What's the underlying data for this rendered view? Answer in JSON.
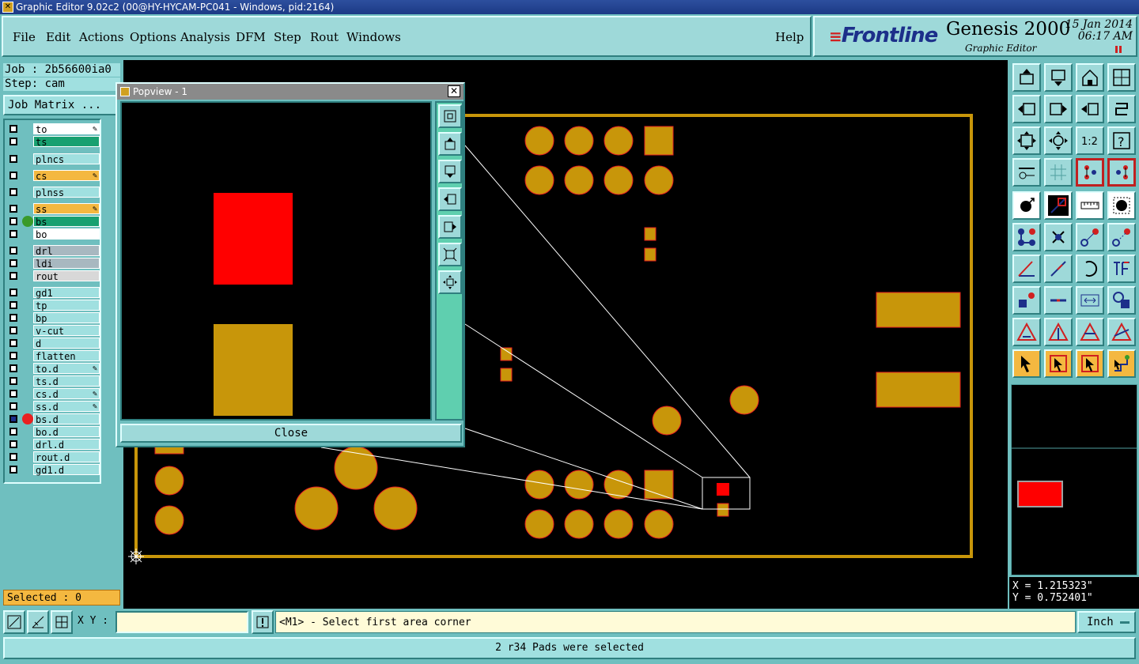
{
  "window": {
    "title": "Graphic Editor 9.02c2 (00@HY-HYCAM-PC041 - Windows, pid:2164)"
  },
  "menu": [
    "File",
    "Edit",
    "Actions",
    "Options",
    "Analysis",
    "DFM",
    "Step",
    "Rout",
    "Windows"
  ],
  "help": "Help",
  "brand": {
    "name": "Frontline",
    "product": "Genesis 2000",
    "subtitle": "Graphic Editor",
    "date": "15 Jan 2014",
    "time": "06:17 AM"
  },
  "job": {
    "job_label": "Job : 2b56600ia0",
    "step_label": "Step: cam",
    "matrix_button": "Job Matrix ..."
  },
  "layers": [
    {
      "name": "to",
      "bg": "#ffffff",
      "editable": true
    },
    {
      "name": "ts",
      "bg": "#18a070",
      "editable": false
    },
    {
      "name": "plncs",
      "bg": "#a0e0e0",
      "editable": false
    },
    {
      "name": "cs",
      "bg": "#f4b840",
      "editable": true
    },
    {
      "name": "plnss",
      "bg": "#a0e0e0",
      "editable": false
    },
    {
      "name": "ss",
      "bg": "#f4b840",
      "editable": true
    },
    {
      "name": "bs",
      "bg": "#18a070",
      "editable": false,
      "dot": "#3a9a2a"
    },
    {
      "name": "bo",
      "bg": "#ffffff",
      "editable": false
    },
    {
      "name": "drl",
      "bg": "#a8b8c0",
      "editable": false
    },
    {
      "name": "ldi",
      "bg": "#a8b8c0",
      "editable": false
    },
    {
      "name": "rout",
      "bg": "#d8d8d8",
      "editable": false
    },
    {
      "name": "gd1",
      "bg": "#a0e0e0",
      "editable": false
    },
    {
      "name": "tp",
      "bg": "#a0e0e0",
      "editable": false
    },
    {
      "name": "bp",
      "bg": "#a0e0e0",
      "editable": false
    },
    {
      "name": "v-cut",
      "bg": "#a0e0e0",
      "editable": false
    },
    {
      "name": "d",
      "bg": "#a0e0e0",
      "editable": false
    },
    {
      "name": "flatten",
      "bg": "#a0e0e0",
      "editable": false
    },
    {
      "name": "to.d",
      "bg": "#a0e0e0",
      "editable": true
    },
    {
      "name": "ts.d",
      "bg": "#a0e0e0",
      "editable": false
    },
    {
      "name": "cs.d",
      "bg": "#a0e0e0",
      "editable": true
    },
    {
      "name": "ss.d",
      "bg": "#a0e0e0",
      "editable": true
    },
    {
      "name": "bs.d",
      "bg": "#a0e0e0",
      "editable": false,
      "dot": "#e82020",
      "active": true
    },
    {
      "name": "bo.d",
      "bg": "#a0e0e0",
      "editable": false
    },
    {
      "name": "drl.d",
      "bg": "#a0e0e0",
      "editable": false
    },
    {
      "name": "rout.d",
      "bg": "#a0e0e0",
      "editable": false
    },
    {
      "name": "gd1.d",
      "bg": "#a0e0e0",
      "editable": false
    }
  ],
  "selected": "Selected : 0",
  "popview": {
    "title": "Popview - 1",
    "close": "Close"
  },
  "coords": {
    "x": "X = 1.215323\"",
    "y": "Y = 0.752401\""
  },
  "xy_label": "X Y :",
  "prompt": "<M1> - Select first area corner",
  "units": "Inch",
  "status": "2 r34 Pads were selected",
  "colors": {
    "pad": "#c8960a",
    "pad_outline": "#e82020",
    "selected": "#ff0000",
    "background": "#6fbfbf"
  }
}
